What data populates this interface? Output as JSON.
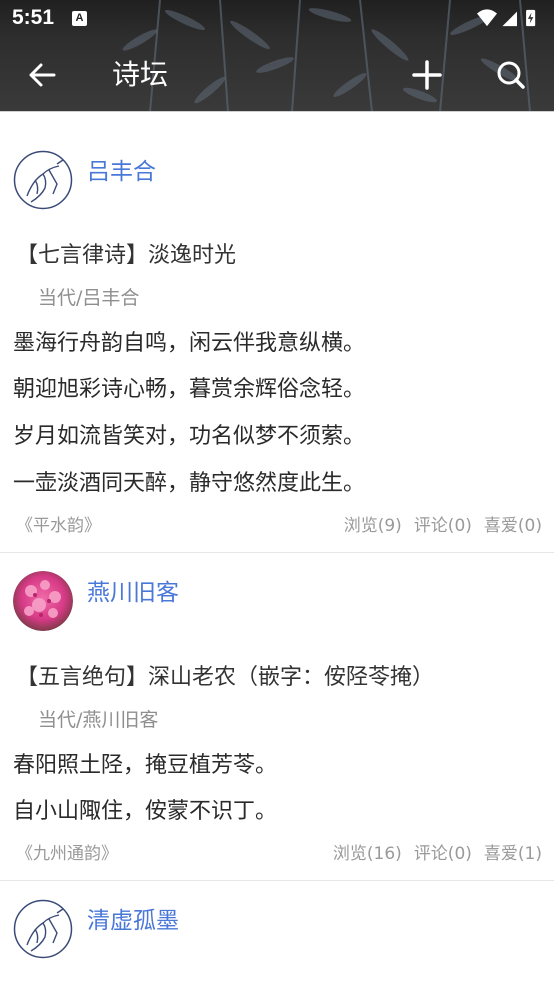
{
  "status": {
    "time": "5:51",
    "notif_letter": "A"
  },
  "toolbar": {
    "title": "诗坛"
  },
  "posts": [
    {
      "author": "吕丰合",
      "title": "【七言律诗】淡逸时光",
      "dynasty_author": "当代/吕丰合",
      "lines": [
        "墨海行舟韵自鸣，闲云伴我意纵横。",
        "朝迎旭彩诗心畅，暮赏余辉俗念轻。",
        "岁月如流皆笑对，功名似梦不须萦。",
        "一壶淡酒同天醉，静守悠然度此生。"
      ],
      "rhyme": "《平水韵》",
      "views": "浏览(9)",
      "comments": "评论(0)",
      "likes": "喜爱(0)"
    },
    {
      "author": "燕川旧客",
      "title": "【五言绝句】深山老农（嵌字：侒陉苓掩）",
      "dynasty_author": "当代/燕川旧客",
      "lines": [
        "春阳照土陉，掩豆植芳苓。",
        "自小山陬住，侒蒙不识丁。"
      ],
      "rhyme": "《九州通韵》",
      "views": "浏览(16)",
      "comments": "评论(0)",
      "likes": "喜爱(1)"
    },
    {
      "author": "清虚孤墨"
    }
  ],
  "colors": {
    "accent": "#4a78d8",
    "appbar": "#2e2e2e"
  }
}
